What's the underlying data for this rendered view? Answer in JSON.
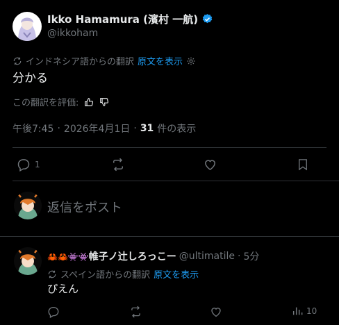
{
  "post": {
    "author_name": "Ikko Hamamura (濱村 一航)",
    "author_handle": "@ikkoham",
    "translation_source": "インドネシア語からの翻訳",
    "show_original": "原文を表示",
    "body": "分かる",
    "rate_translation": "この翻訳を評価:",
    "time": "午後7:45",
    "date": "2026年4月1日",
    "views_count": "31",
    "views_label": "件の表示",
    "dot": "·"
  },
  "actions": {
    "reply_count": "1"
  },
  "composer": {
    "placeholder": "返信をポスト"
  },
  "reply": {
    "emoji_prefix": "🦀🦀👾👾",
    "display_name": "帷子ノ辻しろっこー",
    "handle": "@ultimatile",
    "dot": "·",
    "time": "5分",
    "translation_source": "スペイン語からの翻訳",
    "show_original": "原文を表示",
    "body": "ぴえん",
    "views_count": "10"
  },
  "colors": {
    "background": "#000000",
    "text": "#e7e9ea",
    "muted": "#71767b",
    "accent": "#1d9bf0",
    "divider": "#2f3336"
  },
  "icons": [
    "verified-badge-icon",
    "translate-icon",
    "gear-icon",
    "thumbs-up-icon",
    "thumbs-down-icon",
    "reply-icon",
    "repost-icon",
    "like-icon",
    "bookmark-icon",
    "analytics-icon"
  ]
}
